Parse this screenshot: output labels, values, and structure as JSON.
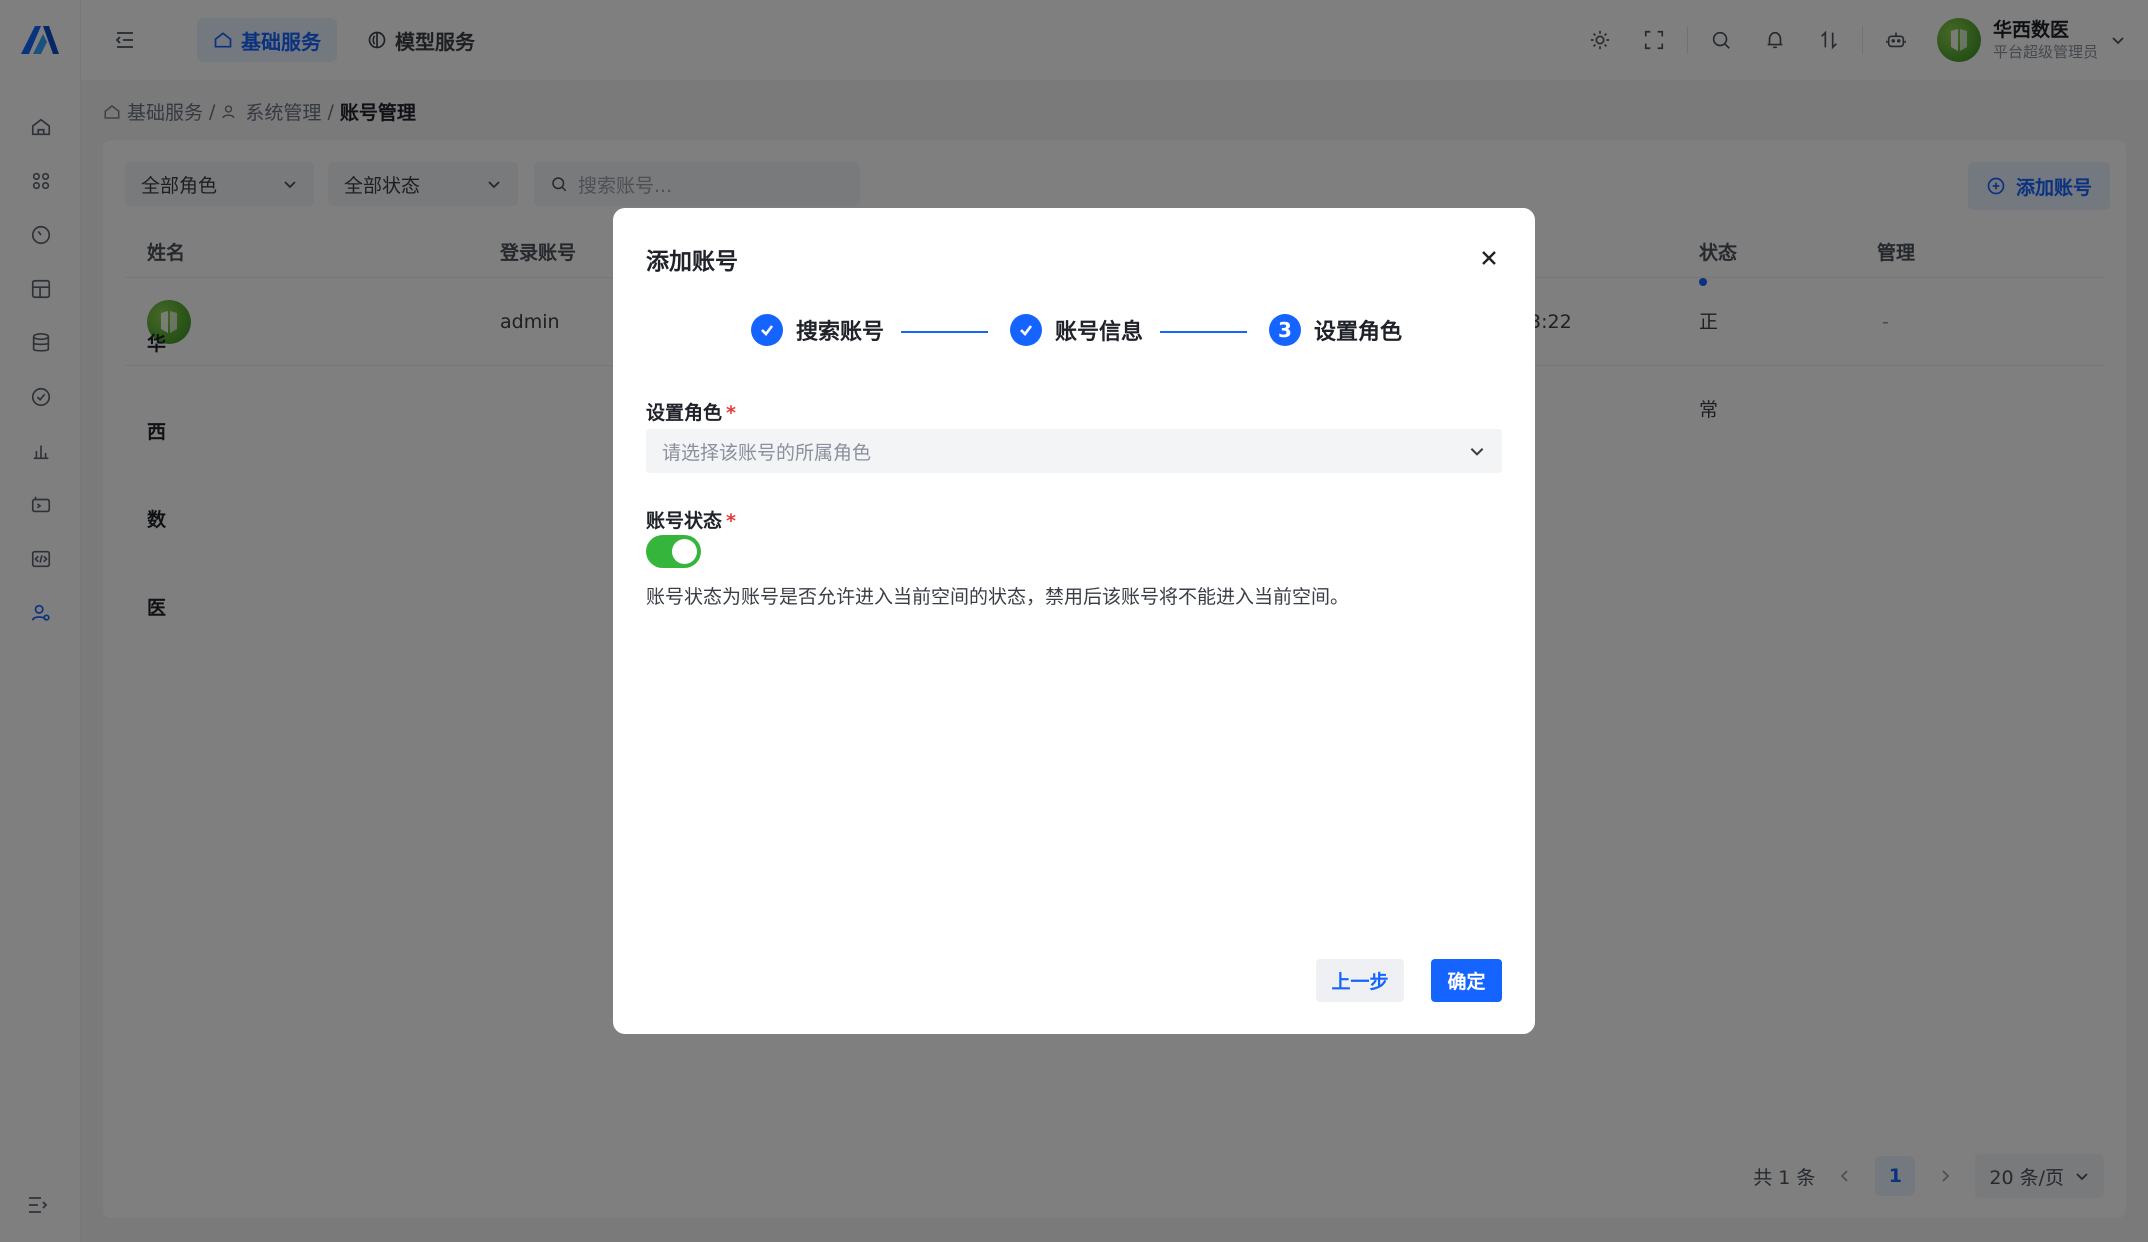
{
  "topbar": {
    "tabs": [
      {
        "label": "基础服务",
        "icon": "home-icon",
        "active": true
      },
      {
        "label": "模型服务",
        "icon": "model-icon",
        "active": false
      }
    ],
    "user": {
      "name": "华西数医",
      "role": "平台超级管理员"
    }
  },
  "breadcrumb": {
    "items": [
      "基础服务",
      "系统管理",
      "账号管理"
    ],
    "separator": "/"
  },
  "filters": {
    "role": "全部角色",
    "status": "全部状态",
    "search_placeholder": "搜索账号..."
  },
  "toolbar": {
    "add_label": "添加账号"
  },
  "table": {
    "columns": [
      "姓名",
      "登录账号",
      "状态",
      "管理"
    ],
    "rows": [
      {
        "name": "华西数医",
        "login": "admin",
        "time_fragment": "3:22",
        "status": "正常",
        "manage": "-"
      }
    ]
  },
  "pagination": {
    "total": "共 1 条",
    "page": "1",
    "page_size": "20 条/页"
  },
  "modal": {
    "title": "添加账号",
    "steps": [
      {
        "label": "搜索账号",
        "state": "done"
      },
      {
        "label": "账号信息",
        "state": "done"
      },
      {
        "label": "设置角色",
        "state": "current",
        "number": "3"
      }
    ],
    "role_label": "设置角色",
    "role_placeholder": "请选择该账号的所属角色",
    "status_label": "账号状态",
    "status_enabled": true,
    "status_hint": "账号状态为账号是否允许进入当前空间的状态，禁用后该账号将不能进入当前空间。",
    "required_mark": "*",
    "prev_label": "上一步",
    "ok_label": "确定"
  },
  "colors": {
    "primary": "#1664ff",
    "toggle_on": "#36b53d",
    "required": "#e53935"
  }
}
